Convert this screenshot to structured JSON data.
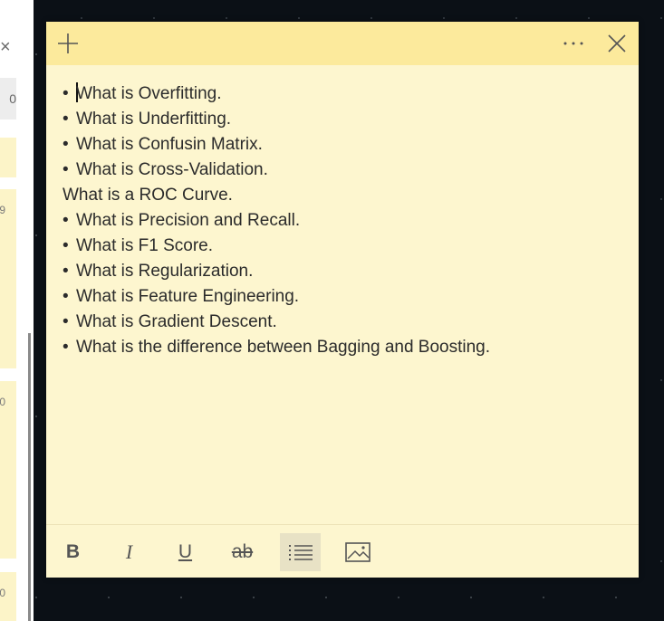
{
  "note": {
    "lines": [
      {
        "bullet": "•",
        "text": "What is Overfitting."
      },
      {
        "bullet": "•",
        "text": "What is Underfitting."
      },
      {
        "bullet": "•",
        "text": "What is Confusin Matrix."
      },
      {
        "bullet": "•",
        "text": "What is Cross-Validation."
      },
      {
        "bullet": "",
        "text": "What is a ROC Curve."
      },
      {
        "bullet": "•",
        "text": "What is Precision and Recall."
      },
      {
        "bullet": "•",
        "text": "What is F1 Score."
      },
      {
        "bullet": "•",
        "text": "What is Regularization."
      },
      {
        "bullet": "•",
        "text": "What is Feature Engineering."
      },
      {
        "bullet": "•",
        "text": "What is Gradient Descent."
      },
      {
        "bullet": "•",
        "text": "What is the difference between Bagging and Boosting."
      }
    ]
  },
  "header": {
    "add_icon": "plus-icon",
    "menu_icon": "more-icon",
    "close_icon": "close-icon",
    "color": "#fcea9c"
  },
  "toolbar": {
    "bold_label": "B",
    "italic_label": "I",
    "underline_label": "U",
    "strike_label": "ab",
    "list_icon": "bullet-list-icon",
    "image_icon": "image-icon"
  },
  "side_panel": {
    "close_glyph": "×",
    "search_fragment": "0",
    "card_tags": [
      "9",
      "0",
      "0"
    ]
  }
}
